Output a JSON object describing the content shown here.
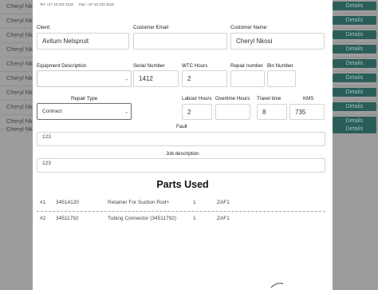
{
  "background_list": {
    "rows": [
      {
        "name": "Cheryl Nko",
        "action": "Details"
      },
      {
        "name": "Cheryl Nko",
        "action": "Details"
      },
      {
        "name": "Cheryl Nko",
        "action": "Details"
      },
      {
        "name": "Cheryl Nko",
        "action": "Details"
      },
      {
        "name": "Cheryl Nko",
        "action": "Details"
      },
      {
        "name": "Cheryl Nko",
        "action": "Details"
      },
      {
        "name": "Cheryl Nko",
        "action": "Details"
      },
      {
        "name": "Cheryl Nko",
        "action": "Details"
      },
      {
        "name": "Cheryl Nko",
        "action": "Details"
      },
      {
        "name": "Cheryl Nko",
        "action": "Details"
      }
    ]
  },
  "modal": {
    "contact": {
      "tel": "Tel: +27 10 222 3115",
      "fax": "Fax: +27 10 222 3119"
    },
    "client": {
      "label": "Client:",
      "value": "Avitum Nelspruit"
    },
    "customer_email": {
      "label": "Customer Email",
      "value": ""
    },
    "customer_name": {
      "label": "Customer Name:",
      "value": "Cheryl Nkosi"
    },
    "equipment_description": {
      "label": "Equipment Description",
      "value": ""
    },
    "serial_number": {
      "label": "Serial Number",
      "value": "1412"
    },
    "wtc_hours": {
      "label": "WTC Hours",
      "value": "2"
    },
    "repair_number": {
      "label": "Repair number",
      "value": ""
    },
    "bin_number": {
      "label": "Bin Number",
      "value": ""
    },
    "repair_type": {
      "label": "Repair Type",
      "value": "Contract"
    },
    "labour_hours": {
      "label": "Labour Hours",
      "value": "2"
    },
    "overtime_hours": {
      "label": "Overtime Hours",
      "value": ""
    },
    "travel_time": {
      "label": "Travel time",
      "value": "8"
    },
    "kms": {
      "label": "KMS",
      "value": "735"
    },
    "fault": {
      "label": "Fault",
      "value": "123"
    },
    "job_description": {
      "label": "Job description",
      "value": "123"
    },
    "parts_title": "Parts Used",
    "parts": [
      {
        "index": "#1",
        "code": "34514120",
        "description": "Retainer For Suction Rod+",
        "qty": "1",
        "location": "ZAF1"
      },
      {
        "index": "#2",
        "code": "34511792",
        "description": "Tubing Connector (34511792)",
        "qty": "1",
        "location": "ZAF1"
      }
    ]
  },
  "icons": {
    "dropdown": "chevron-down-icon"
  }
}
